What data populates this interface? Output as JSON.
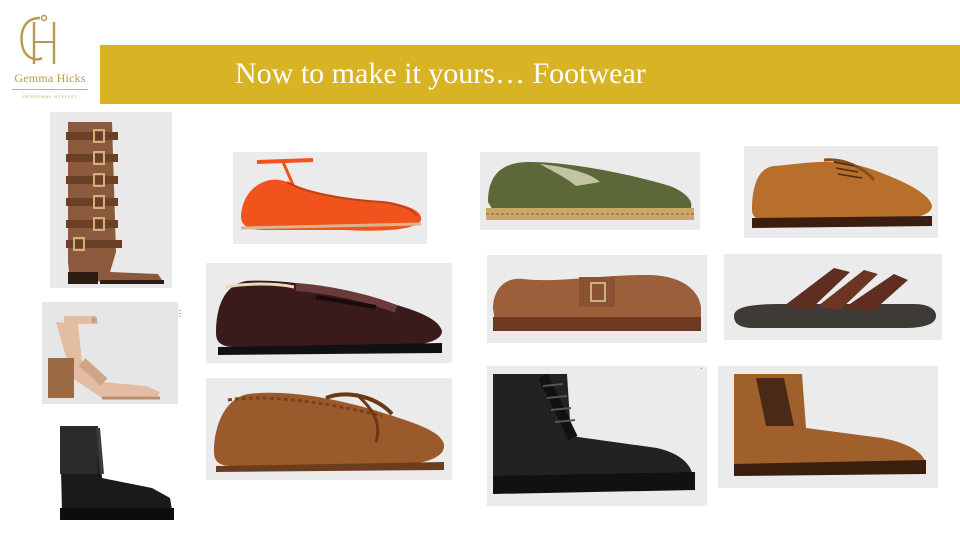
{
  "brand": {
    "monogram": "GH",
    "name": "Gemma Hicks",
    "tagline": "PERSONAL STYLIST",
    "gold": "#d8b323",
    "logo_gold": "#b89a4e"
  },
  "header": {
    "title": "Now to make it yours… Footwear",
    "title_color": "#ffffff"
  },
  "products": [
    {
      "id": "tall-buckle-boot",
      "color": "#8b5a3c"
    },
    {
      "id": "orange-ballet-flat",
      "color": "#f0531c"
    },
    {
      "id": "green-espadrille",
      "color": "#5d6838"
    },
    {
      "id": "tan-derby-shoe",
      "color": "#b86f2c"
    },
    {
      "id": "nude-block-heel-sandal",
      "color": "#e3bda1"
    },
    {
      "id": "burgundy-patent-loafer",
      "color": "#3a1a1a"
    },
    {
      "id": "suede-buckle-clog",
      "color": "#9b5f3b"
    },
    {
      "id": "brown-cross-strap-slide",
      "color": "#5e2e20"
    },
    {
      "id": "black-chelsea-boot",
      "color": "#1a1a1a"
    },
    {
      "id": "suede-boat-shoe",
      "color": "#9a5a2c"
    },
    {
      "id": "black-lace-up-boot",
      "color": "#222222"
    },
    {
      "id": "suede-chelsea-boot",
      "color": "#a0602c"
    }
  ]
}
